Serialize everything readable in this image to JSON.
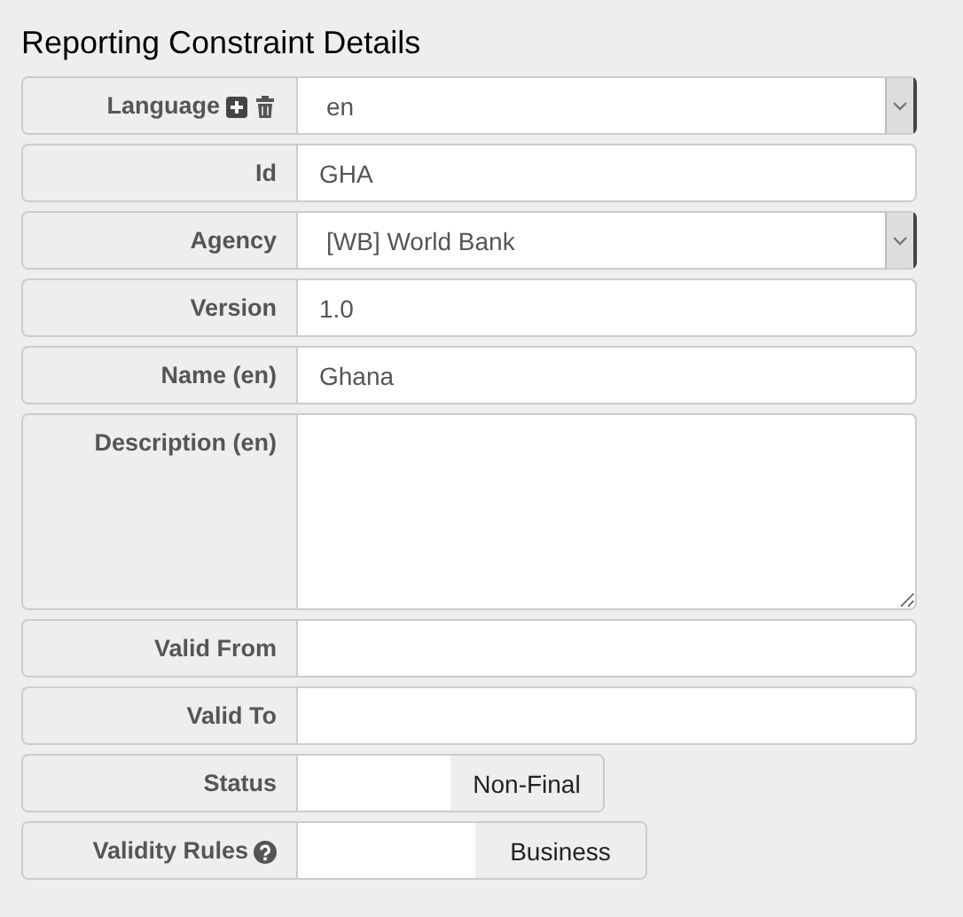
{
  "title": "Reporting Constraint Details",
  "fields": [
    {
      "label": "Language",
      "kind": "select",
      "value": "en",
      "addable": true,
      "removable": true
    },
    {
      "label": "Id",
      "kind": "text",
      "value": "GHA"
    },
    {
      "label": "Agency",
      "kind": "select",
      "value": "[WB] World Bank"
    },
    {
      "label": "Version",
      "kind": "text",
      "value": "1.0"
    },
    {
      "label": "Name (en)",
      "kind": "text",
      "value": "Ghana"
    },
    {
      "label": "Description (en)",
      "kind": "textarea"
    },
    {
      "label": "Valid From",
      "kind": "text"
    },
    {
      "label": "Valid To",
      "kind": "text"
    },
    {
      "label": "Status",
      "kind": "toggle",
      "value": "Non-Final",
      "on": false
    },
    {
      "label": "Validity Rules",
      "kind": "toggle",
      "value": "Business",
      "on": false,
      "help": true
    }
  ]
}
